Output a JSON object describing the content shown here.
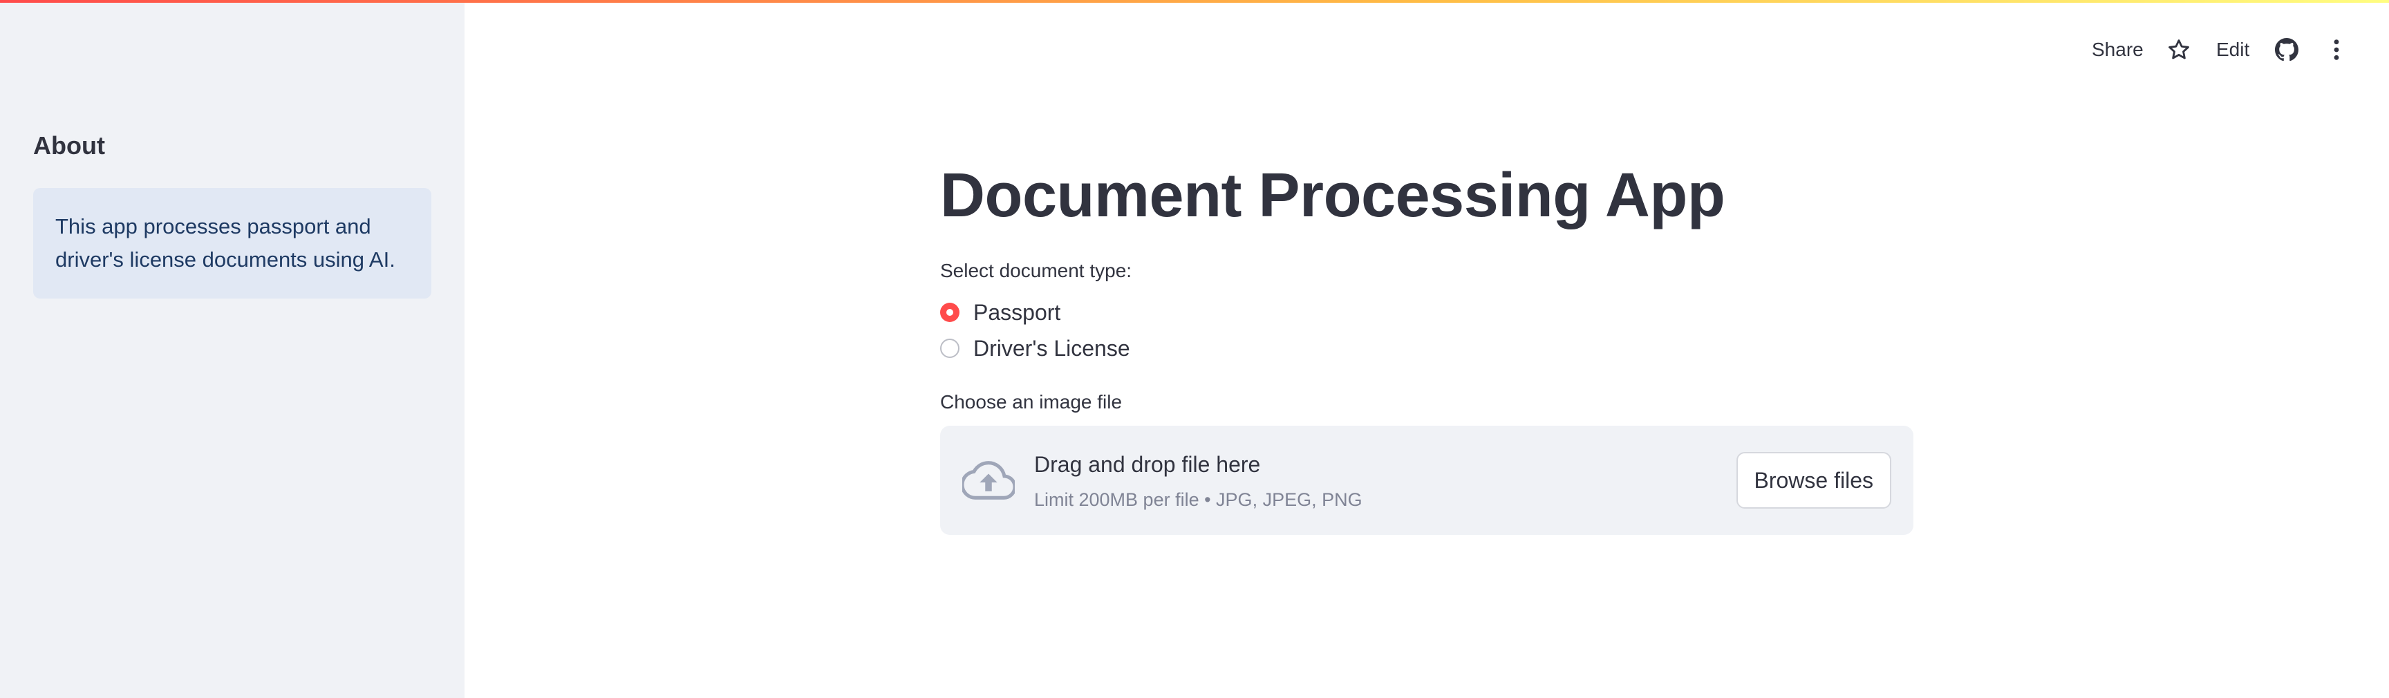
{
  "header": {
    "share_label": "Share",
    "star_icon": "star-icon",
    "edit_label": "Edit",
    "github_icon": "github-icon",
    "menu_icon": "more-vertical-icon"
  },
  "sidebar": {
    "heading": "About",
    "info_text": "This app processes passport and driver's license documents using AI."
  },
  "main": {
    "title": "Document Processing App",
    "doc_type": {
      "label": "Select document type:",
      "options": [
        {
          "label": "Passport",
          "selected": true
        },
        {
          "label": "Driver's License",
          "selected": false
        }
      ]
    },
    "uploader": {
      "label": "Choose an image file",
      "drop_title": "Drag and drop file here",
      "drop_subtitle": "Limit 200MB per file • JPG, JPEG, PNG",
      "browse_label": "Browse files",
      "icon": "cloud-upload-icon"
    }
  },
  "colors": {
    "accent": "#ff4b4b",
    "sidebar_bg": "#f0f2f6",
    "info_bg": "#e1e8f4",
    "info_text": "#1e3a63",
    "text": "#31333f",
    "muted": "#808495"
  }
}
